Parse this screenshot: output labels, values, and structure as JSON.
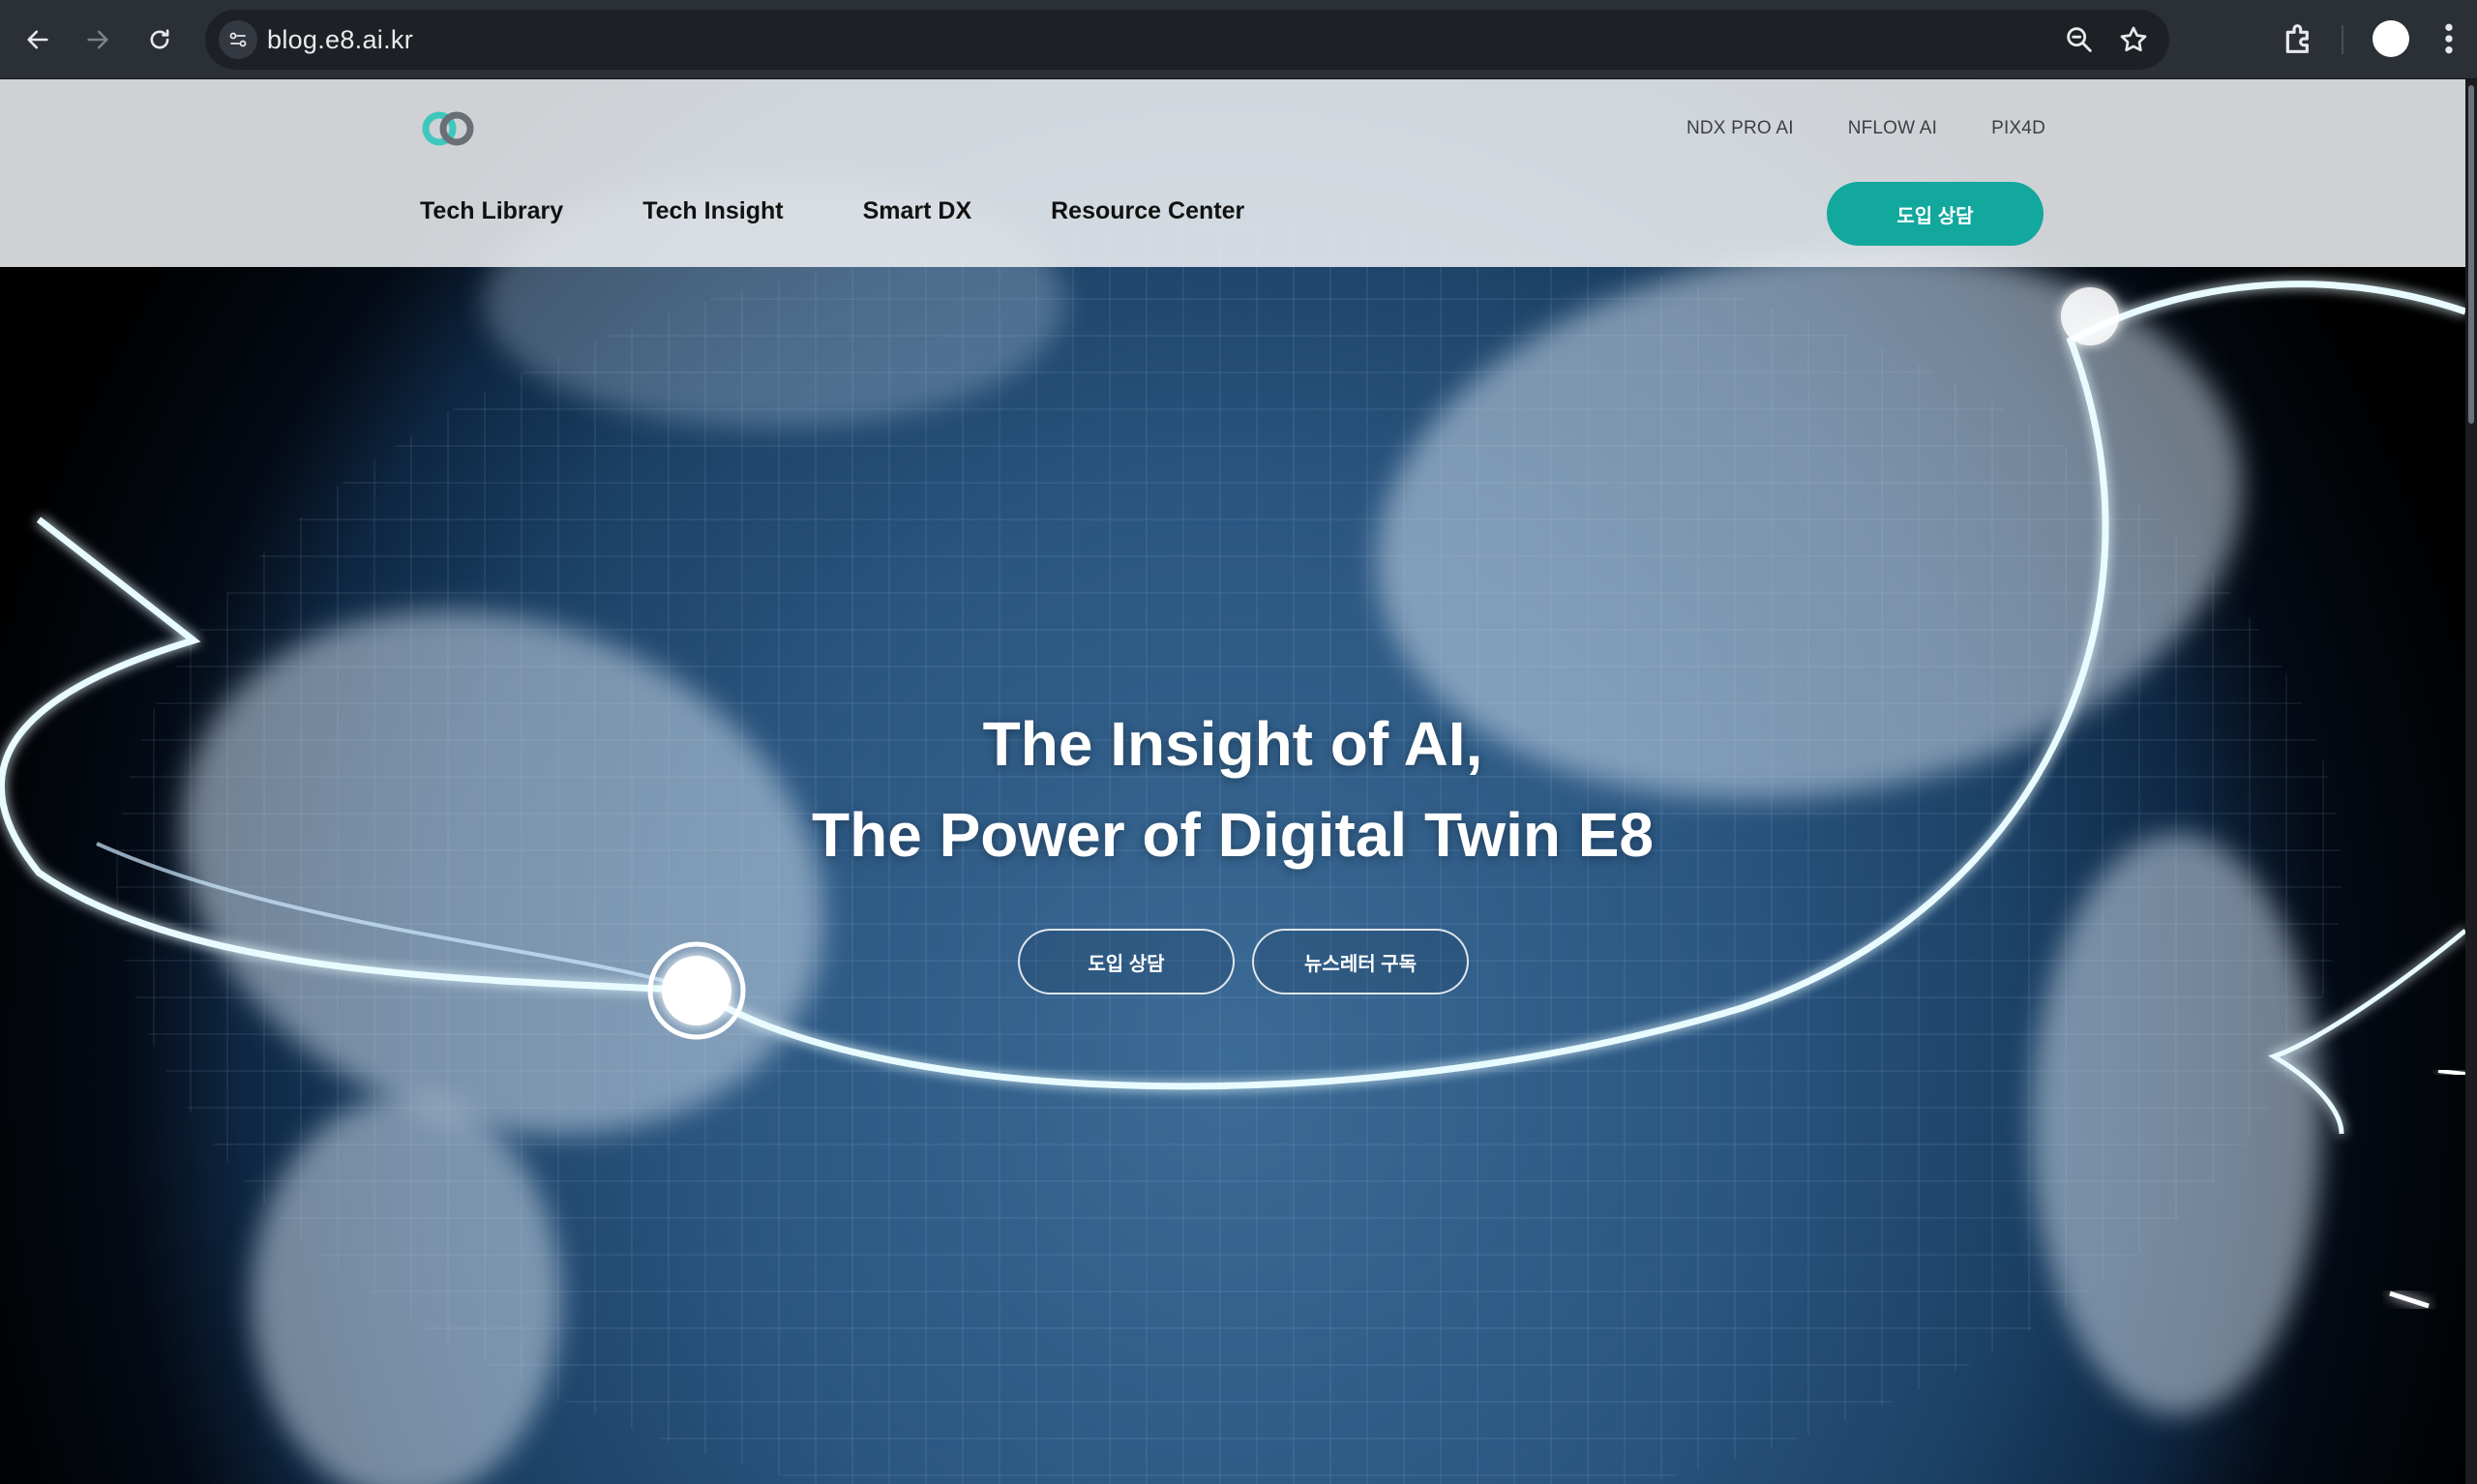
{
  "browser": {
    "url": "blog.e8.ai.kr"
  },
  "header": {
    "utility_links": [
      "NDX PRO AI",
      "NFLOW AI",
      "PIX4D"
    ],
    "nav_items": [
      "Tech Library",
      "Tech Insight",
      "Smart DX",
      "Resource Center"
    ],
    "cta_label": "도입 상담"
  },
  "hero": {
    "title_line1": "The Insight of AI,",
    "title_line2": "The Power of Digital Twin E8",
    "button_consult": "도입 상담",
    "button_newsletter": "뉴스레터 구독"
  },
  "colors": {
    "accent": "#12a89d",
    "chrome": "#2b2f36"
  }
}
